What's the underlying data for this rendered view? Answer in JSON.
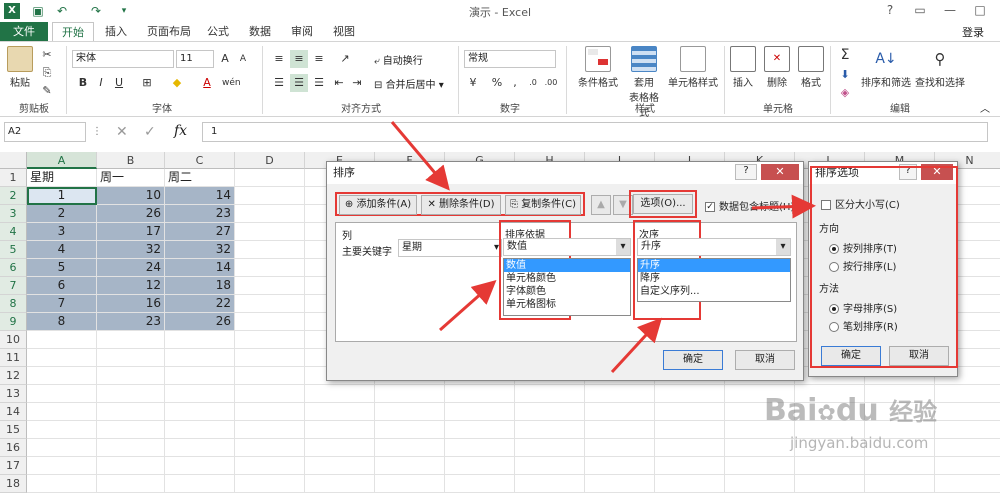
{
  "window": {
    "title": "演示 - Excel",
    "login": "登录"
  },
  "tabs": [
    "文件",
    "开始",
    "插入",
    "页面布局",
    "公式",
    "数据",
    "审阅",
    "视图"
  ],
  "ribbon": {
    "paste": "粘贴",
    "clipboard": "剪贴板",
    "font_name": "宋体",
    "font_size": "11",
    "font_group": "字体",
    "wrap": "自动换行",
    "merge": "合并后居中",
    "align_group": "对齐方式",
    "number_format": "常规",
    "number_group": "数字",
    "cond_format": "条件格式",
    "table_format_1": "套用",
    "table_format_2": "表格格式",
    "cell_style": "单元格样式",
    "style_group": "样式",
    "insert": "插入",
    "delete": "删除",
    "format": "格式",
    "cells_group": "单元格",
    "sort_filter": "排序和筛选",
    "find_select": "查找和选择",
    "edit_group": "编辑",
    "bold": "B",
    "italic": "I",
    "underline": "U",
    "percent": "%",
    "comma": ","
  },
  "formula": {
    "namebox": "A2",
    "value": "1",
    "fx": "fx"
  },
  "sheet": {
    "columns": [
      "A",
      "B",
      "C",
      "D",
      "E",
      "F",
      "G",
      "H",
      "I",
      "J",
      "K",
      "L",
      "M",
      "N"
    ],
    "rows": [
      "1",
      "2",
      "3",
      "4",
      "5",
      "6",
      "7",
      "8",
      "9",
      "10",
      "11",
      "12",
      "13",
      "14",
      "15",
      "16",
      "17",
      "18"
    ],
    "headers": [
      "星期",
      "周一",
      "周二"
    ],
    "data": [
      [
        "1",
        "10",
        "14"
      ],
      [
        "2",
        "26",
        "23"
      ],
      [
        "3",
        "17",
        "27"
      ],
      [
        "4",
        "32",
        "32"
      ],
      [
        "5",
        "24",
        "14"
      ],
      [
        "6",
        "12",
        "18"
      ],
      [
        "7",
        "16",
        "22"
      ],
      [
        "8",
        "23",
        "26"
      ]
    ]
  },
  "sort_dialog": {
    "title": "排序",
    "help": "?",
    "close": "✕",
    "add": "添加条件(A)",
    "delete": "删除条件(D)",
    "copy": "复制条件(C)",
    "options": "选项(O)...",
    "has_header": "数据包含标题(H)",
    "col_header": "列",
    "basis_header": "排序依据",
    "order_header": "次序",
    "row_label": "主要关键字",
    "key_value": "星期",
    "basis_value": "数值",
    "order_value": "升序",
    "basis_options": [
      "数值",
      "单元格颜色",
      "字体颜色",
      "单元格图标"
    ],
    "order_options": [
      "升序",
      "降序",
      "自定义序列..."
    ],
    "ok": "确定",
    "cancel": "取消"
  },
  "options_dialog": {
    "title": "排序选项",
    "help": "?",
    "close": "✕",
    "case": "区分大小写(C)",
    "direction": "方向",
    "by_col": "按列排序(T)",
    "by_row": "按行排序(L)",
    "method": "方法",
    "alpha": "字母排序(S)",
    "stroke": "笔划排序(R)",
    "ok": "确定",
    "cancel": "取消"
  },
  "watermark": {
    "brand": "Bai",
    "brand2": "du",
    "brand3": "经验",
    "url": "jingyan.baidu.com"
  },
  "colors": {
    "excel_green": "#217346",
    "selection": "#b3c5d9",
    "annot_red": "#e53935"
  }
}
